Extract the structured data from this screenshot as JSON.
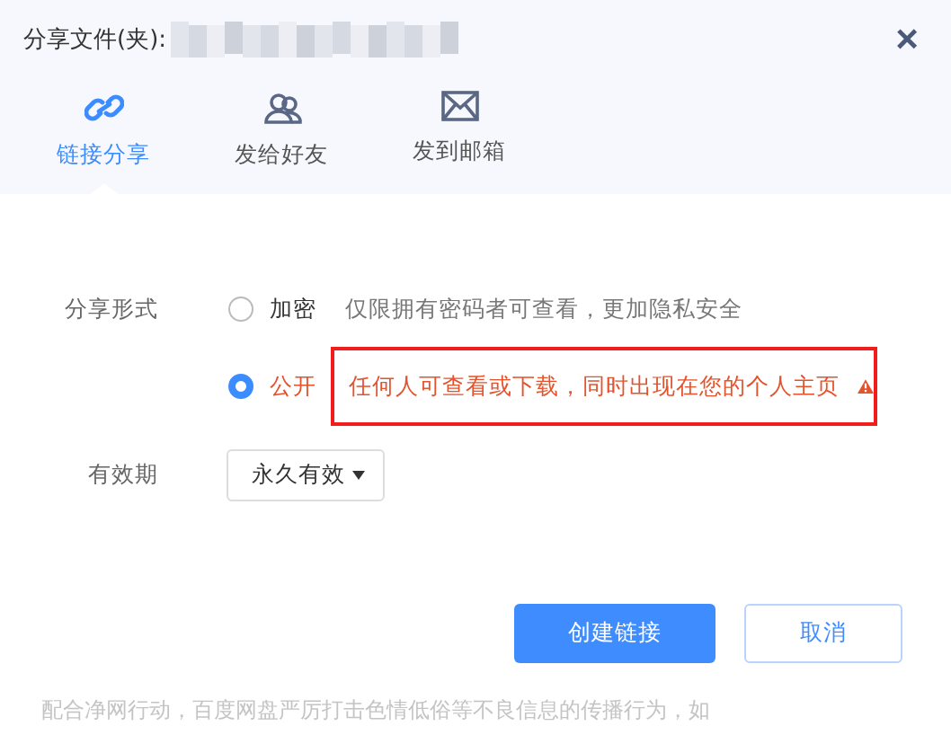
{
  "dialog": {
    "title": "分享文件(夹):",
    "close": "×"
  },
  "tabs": [
    {
      "label": "链接分享",
      "selected": true
    },
    {
      "label": "发给好友",
      "selected": false
    },
    {
      "label": "发到邮箱",
      "selected": false
    }
  ],
  "share_mode": {
    "label": "分享形式",
    "options": [
      {
        "label": "加密",
        "hint": "仅限拥有密码者可查看，更加隐私安全",
        "selected": false,
        "highlighted": false
      },
      {
        "label": "公开",
        "hint": "任何人可查看或下载，同时出现在您的个人主页",
        "selected": true,
        "highlighted": true
      }
    ]
  },
  "validity": {
    "label": "有效期",
    "value": "永久有效"
  },
  "buttons": [
    {
      "label": "创建链接",
      "kind": "primary"
    },
    {
      "label": "取消",
      "kind": "secondary"
    }
  ],
  "notice": "配合净网行动，百度网盘严厉打击色情低俗等不良信息的传播行为，如"
}
